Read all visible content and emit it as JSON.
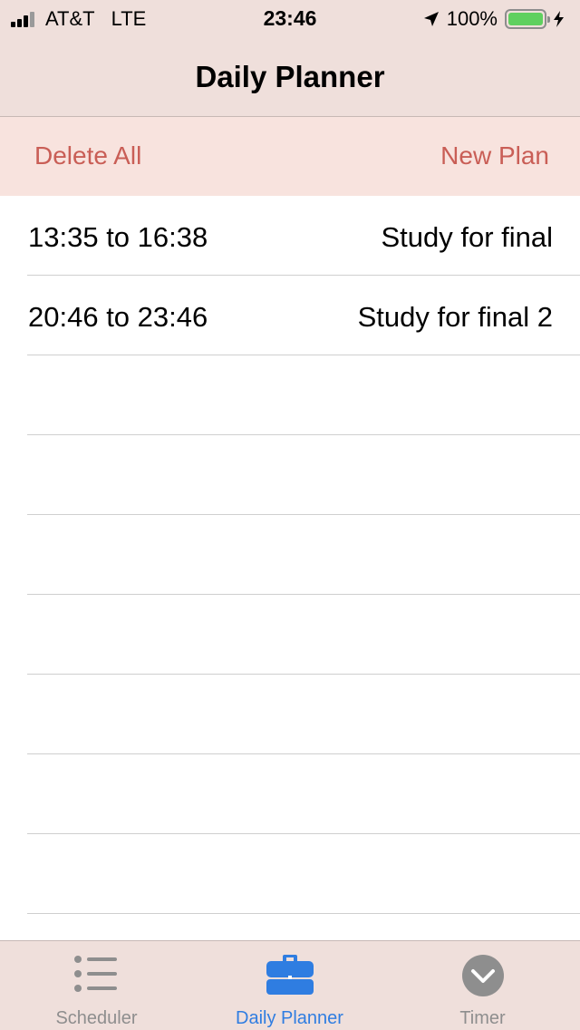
{
  "status_bar": {
    "carrier": "AT&T",
    "network": "LTE",
    "time": "23:46",
    "battery": "100%",
    "battery_level": 1.0
  },
  "nav": {
    "title": "Daily Planner"
  },
  "toolbar": {
    "delete_all_label": "Delete All",
    "new_plan_label": "New Plan",
    "accent_color": "#c95e56"
  },
  "plans": [
    {
      "time": "13:35 to 16:38",
      "title": "Study for final"
    },
    {
      "time": "20:46 to 23:46",
      "title": "Study for final 2"
    }
  ],
  "tabs": [
    {
      "label": "Scheduler",
      "icon": "list-icon",
      "active": false
    },
    {
      "label": "Daily Planner",
      "icon": "briefcase-icon",
      "active": true
    },
    {
      "label": "Timer",
      "icon": "chevron-circle-icon",
      "active": false
    }
  ],
  "colors": {
    "bar_background": "#efdfdb",
    "toolbar_background": "#f8e3de",
    "active_tab": "#2f7de1",
    "inactive_tab": "#8e8e8e"
  }
}
